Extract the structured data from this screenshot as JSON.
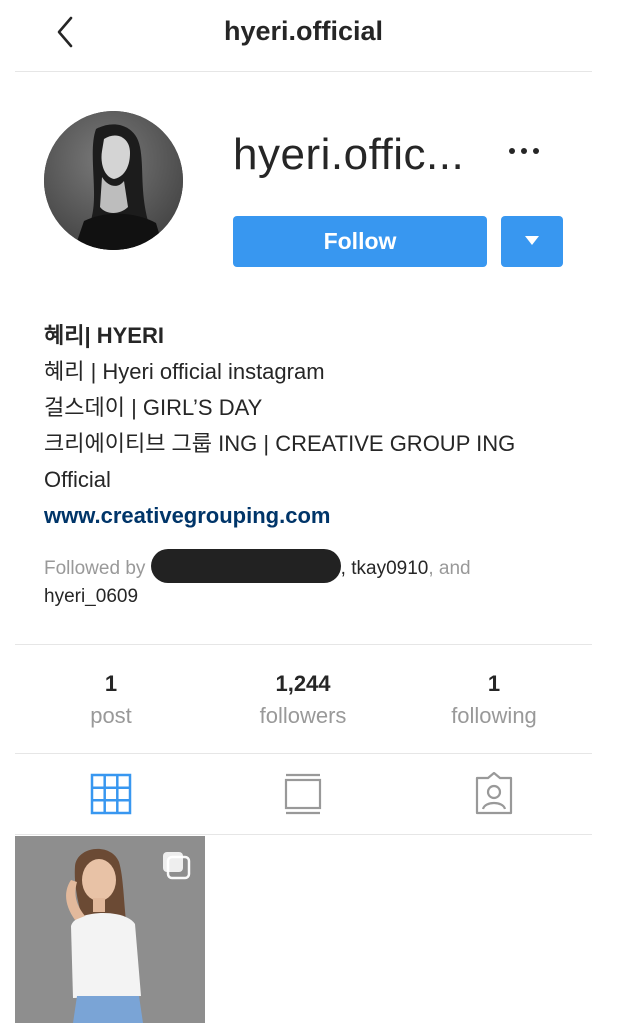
{
  "header": {
    "title": "hyeri.official"
  },
  "profile": {
    "username_display": "hyeri.offic...",
    "follow_label": "Follow",
    "bio": {
      "name": "혜리| HYERI",
      "lines": [
        "혜리 | Hyeri official instagram",
        "걸스데이 | GIRL’S DAY",
        "크리에이티브 그룹 ING | CREATIVE GROUP ING",
        "Official"
      ],
      "website": "www.creativegrouping.com"
    },
    "followed_by": {
      "prefix": "Followed by",
      "user2": "tkay0910",
      "joiner": ", and",
      "user3": "hyeri_0609"
    }
  },
  "stats": [
    {
      "value": "1",
      "label": "post"
    },
    {
      "value": "1,244",
      "label": "followers"
    },
    {
      "value": "1",
      "label": "following"
    }
  ],
  "tabs": [
    {
      "icon": "grid-icon",
      "active": true
    },
    {
      "icon": "feed-icon",
      "active": false
    },
    {
      "icon": "tagged-icon",
      "active": false
    }
  ],
  "colors": {
    "accent": "#3897f0",
    "link": "#003569",
    "muted": "#999999",
    "text": "#262626"
  }
}
